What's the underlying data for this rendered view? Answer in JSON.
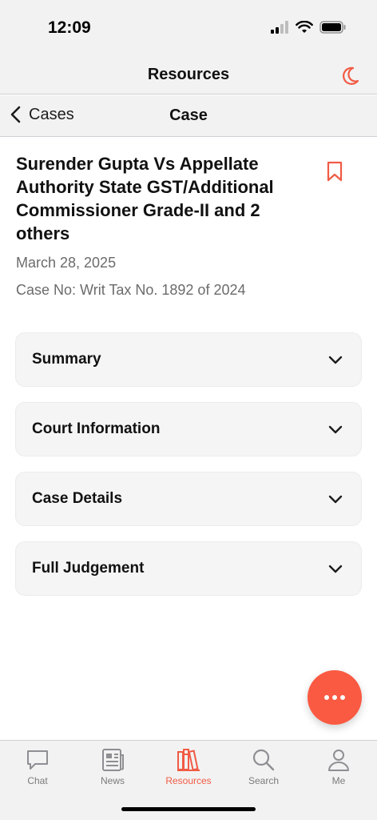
{
  "status": {
    "time": "12:09"
  },
  "header": {
    "title": "Resources"
  },
  "nav": {
    "back_label": "Cases",
    "title": "Case"
  },
  "case": {
    "title": "Surender Gupta Vs Appellate Authority State GST/Additional Commissioner Grade-II and 2 others",
    "date": "March 28, 2025",
    "case_no": "Case No: Writ Tax No. 1892 of 2024"
  },
  "sections": [
    {
      "label": "Summary"
    },
    {
      "label": "Court Information"
    },
    {
      "label": "Case Details"
    },
    {
      "label": "Full Judgement"
    }
  ],
  "tabs": [
    {
      "label": "Chat",
      "icon": "chat-icon"
    },
    {
      "label": "News",
      "icon": "news-icon"
    },
    {
      "label": "Resources",
      "icon": "books-icon",
      "active": true
    },
    {
      "label": "Search",
      "icon": "search-icon"
    },
    {
      "label": "Me",
      "icon": "person-icon"
    }
  ],
  "colors": {
    "accent": "#f15a44",
    "fab": "#fa5a42"
  }
}
